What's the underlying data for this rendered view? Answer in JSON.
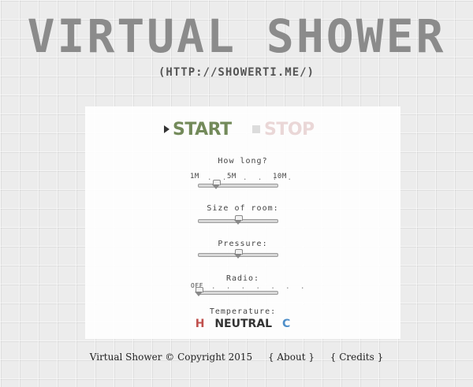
{
  "header": {
    "title": "VIRTUAL SHOWER",
    "url": "(HTTP://SHOWERTI.ME/)"
  },
  "controls": {
    "start_label": "START",
    "stop_label": "STOP",
    "start_icon": "play-triangle-icon",
    "stop_icon": "stop-square-icon"
  },
  "sliders": {
    "how_long": {
      "label": "How long?",
      "scale_min": "1M",
      "scale_mid": "5M",
      "scale_max": "10M",
      "value_fraction": 0.22
    },
    "size_of_room": {
      "label": "Size of room:",
      "value_fraction": 0.5
    },
    "pressure": {
      "label": "Pressure:",
      "value_fraction": 0.5
    },
    "radio": {
      "label": "Radio:",
      "off_label": "OFF",
      "value_fraction": 0.0
    }
  },
  "temperature": {
    "label": "Temperature:",
    "hot": "H",
    "neutral": "NEUTRAL",
    "cold": "C",
    "hot_color": "#c0504d",
    "cold_color": "#4f8fc9",
    "neutral_color": "#333333"
  },
  "footer": {
    "copyright": "Virtual Shower © Copyright 2015",
    "about": "{ About }",
    "credits": "{ Credits }"
  },
  "colors": {
    "start": "#738a5a",
    "stop": "#ead7d7",
    "title": "#8b8b8b"
  }
}
